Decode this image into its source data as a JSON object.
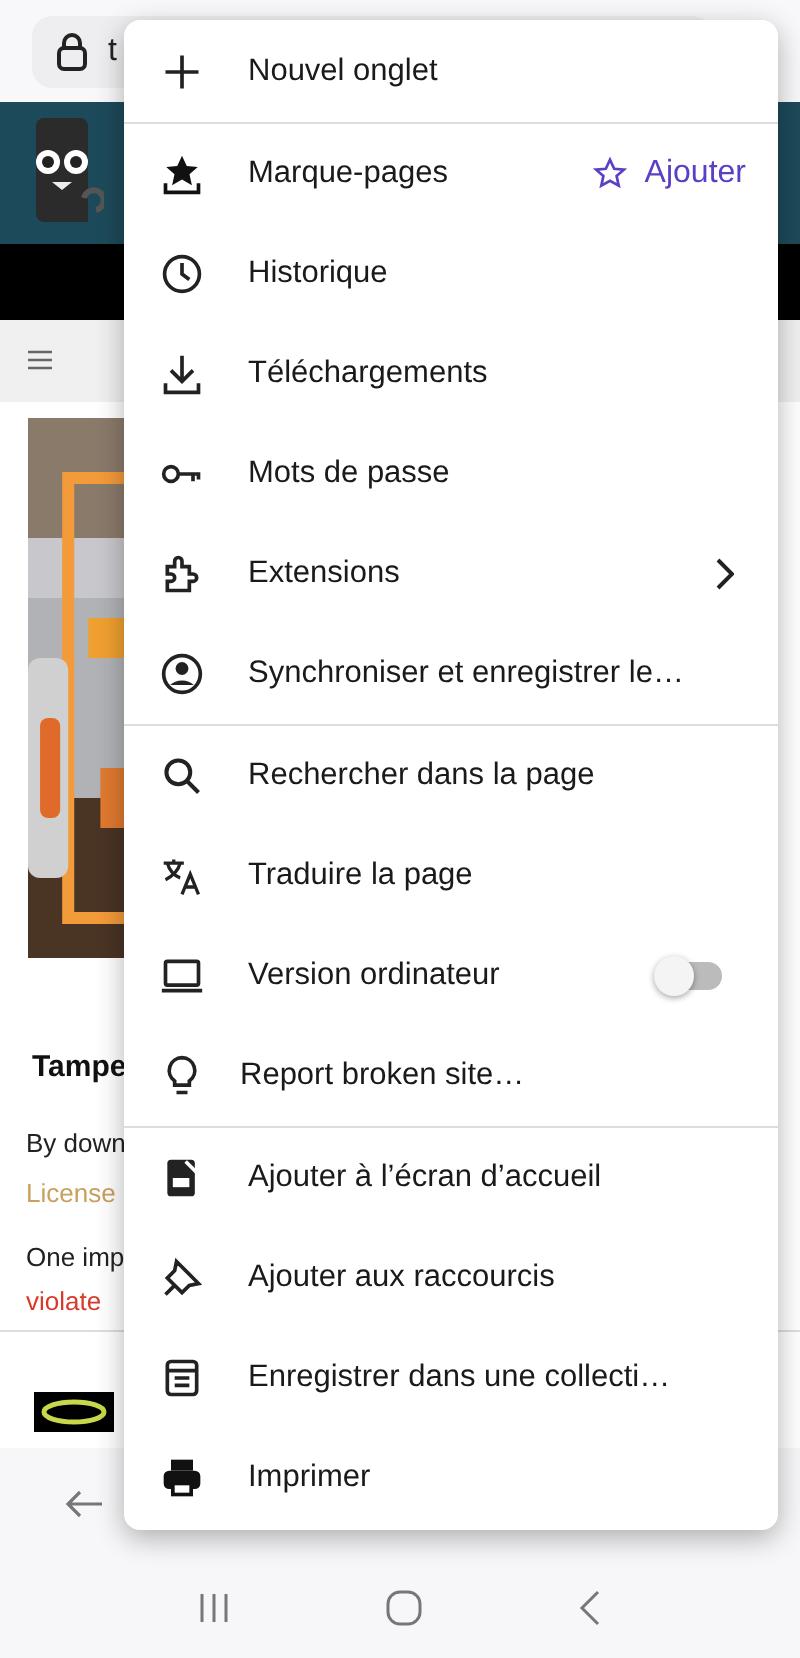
{
  "address_bar": {
    "url": "t"
  },
  "page": {
    "heading": "Tampe",
    "lines": [
      {
        "text": "By down",
        "kind": "plain"
      },
      {
        "text": "License",
        "kind": "link"
      },
      {
        "text": "One imp",
        "kind": "plain"
      },
      {
        "text": "violate",
        "kind": "warning"
      }
    ]
  },
  "menu": {
    "items": [
      {
        "label": "Nouvel onglet",
        "kind": "plain",
        "divider_after": true
      },
      {
        "label": "Marque-pages",
        "kind": "action",
        "action": "Ajouter",
        "divider_after": false
      },
      {
        "label": "Historique",
        "kind": "plain",
        "divider_after": false
      },
      {
        "label": "Téléchargements",
        "kind": "plain",
        "divider_after": false
      },
      {
        "label": "Mots de passe",
        "kind": "plain",
        "divider_after": false
      },
      {
        "label": "Extensions",
        "kind": "submenu",
        "divider_after": false
      },
      {
        "label": "Synchroniser et enregistrer le…",
        "kind": "plain",
        "divider_after": true
      },
      {
        "label": "Rechercher dans la page",
        "kind": "plain",
        "divider_after": false
      },
      {
        "label": "Traduire la page",
        "kind": "plain",
        "divider_after": false
      },
      {
        "label": "Version ordinateur",
        "kind": "toggle",
        "on": false,
        "divider_after": false
      },
      {
        "label": "Report broken site…",
        "kind": "plain",
        "divider_after": true
      },
      {
        "label": "Ajouter à l’écran d’accueil",
        "kind": "plain",
        "divider_after": false
      },
      {
        "label": "Ajouter aux raccourcis",
        "kind": "plain",
        "divider_after": false
      },
      {
        "label": "Enregistrer dans une collecti…",
        "kind": "plain",
        "divider_after": false
      },
      {
        "label": "Imprimer",
        "kind": "plain",
        "divider_after": false
      }
    ]
  }
}
